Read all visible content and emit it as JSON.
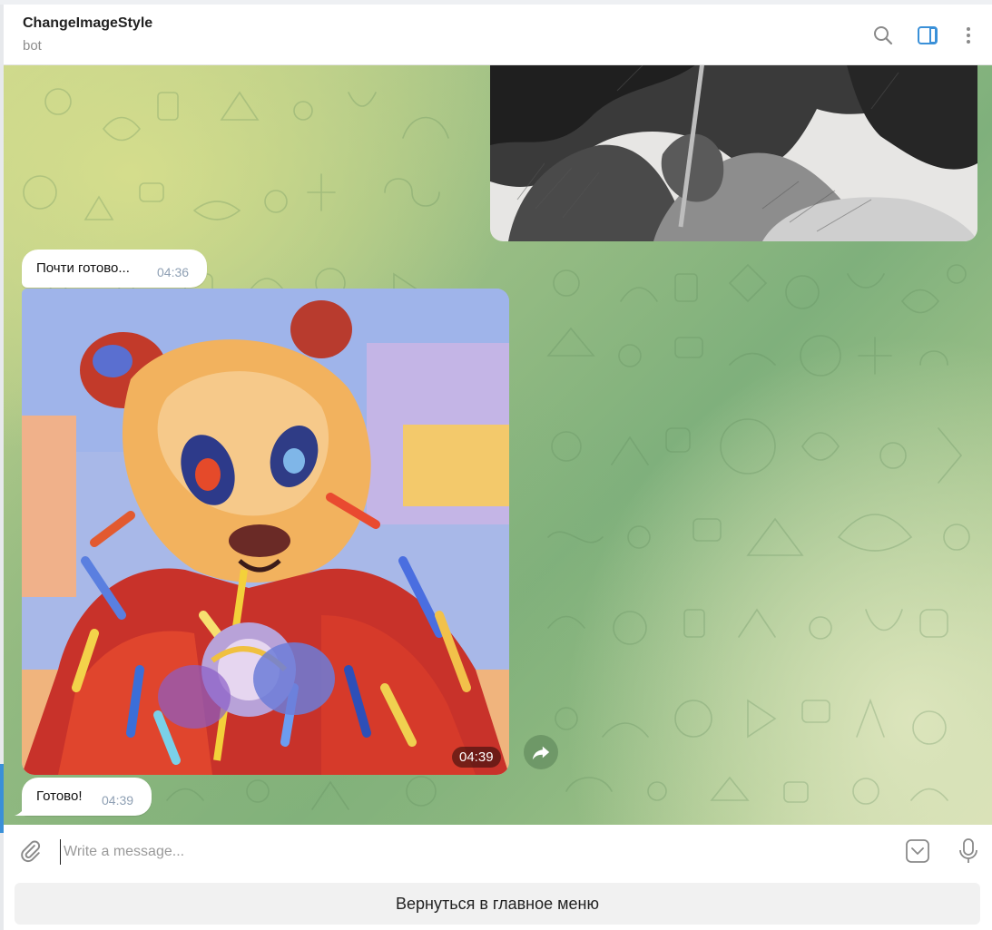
{
  "header": {
    "title": "ChangeImageStyle",
    "status": "bot",
    "icons": [
      "search-icon",
      "sidebar-toggle-icon",
      "more-vertical-icon"
    ]
  },
  "messages": [
    {
      "type": "photo",
      "style": "pencil sketch"
    },
    {
      "type": "text",
      "text": "Почти готово...",
      "time": "04:36"
    },
    {
      "type": "photo",
      "style": "colorful painting",
      "time": "04:39"
    },
    {
      "type": "text",
      "text": "Готово!",
      "time": "04:39"
    }
  ],
  "composer": {
    "placeholder": "Write a message...",
    "value": "",
    "icons": [
      "paperclip-icon",
      "sticker-icon",
      "microphone-icon"
    ]
  },
  "keyboard": {
    "buttons": [
      {
        "label": "Вернуться в главное меню"
      }
    ]
  },
  "colors": {
    "accent": "#3a90d8",
    "bubble": "#ffffff",
    "time_text": "#8fa0b4",
    "wallpaper_green": "#8fb981",
    "wallpaper_yellow": "#d2d98f"
  }
}
